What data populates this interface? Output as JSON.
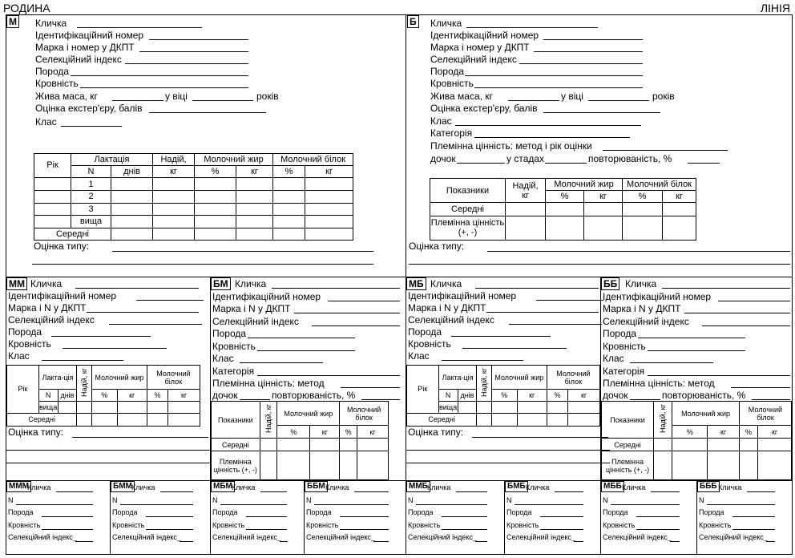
{
  "header": {
    "left": "РОДИНА",
    "right": "ЛІНІЯ"
  },
  "m": {
    "tag": "М",
    "fields": [
      "Кличка",
      "Ідентифікаційний номер",
      "Марка і номер у ДКПТ",
      "Селекційний індекс",
      "Порода",
      "Кровність"
    ],
    "live_weight": {
      "a": "Жива маса, кг",
      "b": "у віці",
      "c": "років"
    },
    "exterior": "Оцінка екстер'єру, балів",
    "class": "Клас",
    "table": {
      "year": "Рік",
      "lactation": "Лактація",
      "n": "N",
      "days": "днів",
      "yield": "Надій,",
      "kg": "кг",
      "fat": "Молочний жир",
      "protein": "Молочний білок",
      "pct": "%",
      "rows": [
        "1",
        "2",
        "3",
        "вища"
      ],
      "avg": "Середні"
    },
    "type_score": "Оцінка типу:"
  },
  "b": {
    "tag": "Б",
    "fields": [
      "Кличка",
      "Ідентифікаційний номер",
      "Марка і номер у ДКПТ",
      "Селекційний індекс",
      "Порода",
      "Кровність"
    ],
    "live_weight": {
      "a": "Жива маса, кг",
      "b": "у віці",
      "c": "років"
    },
    "exterior": "Оцінка екстер'єру, балів",
    "class": "Клас",
    "category": "Категорія",
    "breeding_value": "Племінна цінність: метод і рік оцінки",
    "daughters": {
      "a": "дочок",
      "b": "у стадах",
      "c": "повторюваність, %"
    },
    "table": {
      "indicators": "Показники",
      "yield": "Надій,",
      "kg": "кг",
      "fat": "Молочний жир",
      "protein": "Молочний білок",
      "pct": "%",
      "avg": "Середні",
      "bv": "Племінна цінність (+, -)"
    },
    "type_score": "Оцінка типу:"
  },
  "dams": [
    {
      "tag": "ММ"
    },
    {
      "tag": "МБ"
    }
  ],
  "dam_fields": [
    "Кличка",
    "Ідентифікаційний номер",
    "Марка і N у ДКПТ",
    "Селекційний індекс",
    "Порода",
    "Кровність",
    "Клас"
  ],
  "dam_table": {
    "year": "Рік",
    "lactation": "Лакта-ція",
    "yield": "Надій, кг",
    "fat": "Молочний жир",
    "protein": "Молочний білок",
    "n": "N",
    "days": "днів",
    "pct": "%",
    "kg": "кг",
    "top": "вища",
    "avg": "Середні"
  },
  "sires": [
    {
      "tag": "БМ"
    },
    {
      "tag": "ББ"
    }
  ],
  "sire_fields": [
    "Кличка",
    "Ідентифікаційний номер",
    "Марка і N у ДКПТ",
    "Селекційний індекс",
    "Порода",
    "Кровність",
    "Клас",
    "Категорія"
  ],
  "sire_bv": {
    "a": "Племінна цінність: метод",
    "b": "дочок",
    "c": "повторюваність, %"
  },
  "sire_table": {
    "indicators": "Показники",
    "yield": "Надій, кг",
    "fat": "Молочний жир",
    "protein": "Молочний білок",
    "pct": "%",
    "kg": "кг",
    "avg": "Середні",
    "bv": "Племінна цінність (+, -)"
  },
  "type_score": "Оцінка типу:",
  "bottom": {
    "tags": [
      "МММ",
      "БММ",
      "МБМ",
      "ББМ",
      "ММБ",
      "БМБ",
      "МББ",
      "БББ"
    ],
    "fields": [
      "Кличка",
      "N",
      "Порода",
      "Кровність",
      "Селекційний індекс_"
    ]
  }
}
